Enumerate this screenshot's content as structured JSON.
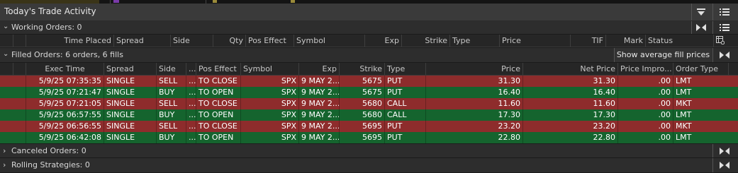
{
  "panel": {
    "title": "Today's Trade Activity"
  },
  "working": {
    "label": "Working Orders: 0",
    "columns": [
      "Time Placed",
      "Spread",
      "Side",
      "Qty",
      "Pos Effect",
      "Symbol",
      "Exp",
      "Strike",
      "Type",
      "Price",
      "TIF",
      "Mark",
      "Status"
    ]
  },
  "filled": {
    "label": "Filled Orders: 6 orders, 6 fills",
    "avg_button": "Show average fill prices",
    "columns": [
      "Exec Time",
      "Spread",
      "Side",
      "...",
      "Pos Effect",
      "Symbol",
      "Exp",
      "Strike",
      "Type",
      "Price",
      "Net Price",
      "Price Impro...",
      "Order Type"
    ],
    "rows": [
      {
        "time": "5/9/25 07:35:35",
        "spread": "SINGLE",
        "side": "SELL",
        "qty": "...",
        "pos": "TO CLOSE",
        "sym": "SPX",
        "exp": "9 MAY 2...",
        "strike": "5675",
        "type": "PUT",
        "price": "31.30",
        "net": "31.30",
        "impr": ".00",
        "otype": "LMT",
        "color": "red"
      },
      {
        "time": "5/9/25 07:21:47",
        "spread": "SINGLE",
        "side": "BUY",
        "qty": "...",
        "pos": "TO OPEN",
        "sym": "SPX",
        "exp": "9 MAY 2...",
        "strike": "5675",
        "type": "PUT",
        "price": "16.40",
        "net": "16.40",
        "impr": ".00",
        "otype": "LMT",
        "color": "green"
      },
      {
        "time": "5/9/25 07:21:05",
        "spread": "SINGLE",
        "side": "SELL",
        "qty": "...",
        "pos": "TO CLOSE",
        "sym": "SPX",
        "exp": "9 MAY 2...",
        "strike": "5680",
        "type": "CALL",
        "price": "11.60",
        "net": "11.60",
        "impr": ".00",
        "otype": "MKT",
        "color": "red"
      },
      {
        "time": "5/9/25 06:57:55",
        "spread": "SINGLE",
        "side": "BUY",
        "qty": "...",
        "pos": "TO OPEN",
        "sym": "SPX",
        "exp": "9 MAY 2...",
        "strike": "5680",
        "type": "CALL",
        "price": "17.30",
        "net": "17.30",
        "impr": ".00",
        "otype": "LMT",
        "color": "green"
      },
      {
        "time": "5/9/25 06:56:55",
        "spread": "SINGLE",
        "side": "SELL",
        "qty": "...",
        "pos": "TO CLOSE",
        "sym": "SPX",
        "exp": "9 MAY 2...",
        "strike": "5695",
        "type": "PUT",
        "price": "23.20",
        "net": "23.20",
        "impr": ".00",
        "otype": "MKT",
        "color": "red"
      },
      {
        "time": "5/9/25 06:42:08",
        "spread": "SINGLE",
        "side": "BUY",
        "qty": "...",
        "pos": "TO OPEN",
        "sym": "SPX",
        "exp": "9 MAY 2...",
        "strike": "5695",
        "type": "PUT",
        "price": "22.80",
        "net": "22.80",
        "impr": ".00",
        "otype": "LMT",
        "color": "green"
      }
    ]
  },
  "canceled": {
    "label": "Canceled Orders: 0"
  },
  "rolling": {
    "label": "Rolling Strategies: 0"
  },
  "colors": {
    "sell_row": "#8e2c2c",
    "buy_row": "#15642e",
    "bg": "#1d1d1d"
  }
}
